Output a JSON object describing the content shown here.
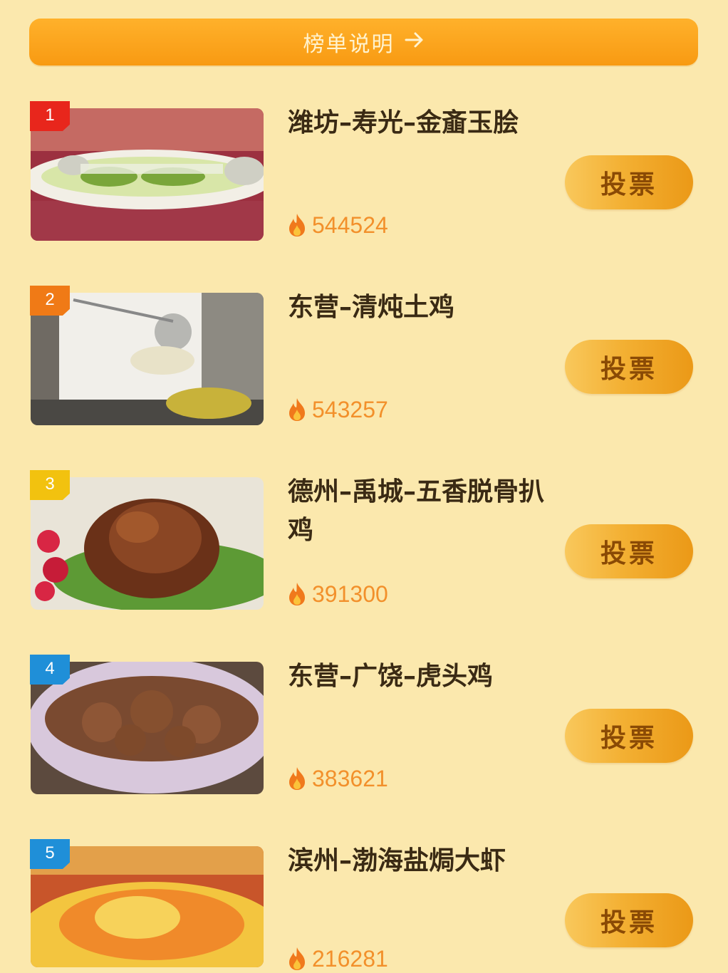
{
  "banner": {
    "label": "榜单说明",
    "arrow_icon": "arrow-right-icon"
  },
  "items": [
    {
      "rank": "1",
      "name": "潍坊–寿光–金齑玉脍",
      "heat": "544524",
      "vote_label": "投票",
      "rank_color": "#e8261c",
      "photo": "fish-platter"
    },
    {
      "rank": "2",
      "name": "东营–清炖土鸡",
      "heat": "543257",
      "vote_label": "投票",
      "rank_color": "#f07a16",
      "photo": "chef-soup"
    },
    {
      "rank": "3",
      "name": "德州–禹城–五香脱骨扒鸡",
      "heat": "391300",
      "vote_label": "投票",
      "rank_color": "#f2c20f",
      "photo": "braised-chicken"
    },
    {
      "rank": "4",
      "name": "东营–广饶–虎头鸡",
      "heat": "383621",
      "vote_label": "投票",
      "rank_color": "#1f8fd8",
      "photo": "meatball-bowl"
    },
    {
      "rank": "5",
      "name": "滨州–渤海盐焗大虾",
      "heat": "216281",
      "vote_label": "投票",
      "rank_color": "#1f8fd8",
      "photo": "shrimp-platter"
    }
  ],
  "icons": {
    "heat": "flame-icon"
  },
  "colors": {
    "background": "#fbe8ad",
    "banner": "#f9a51d",
    "vote_button": "#f3b033",
    "heat_text": "#f2902b"
  }
}
